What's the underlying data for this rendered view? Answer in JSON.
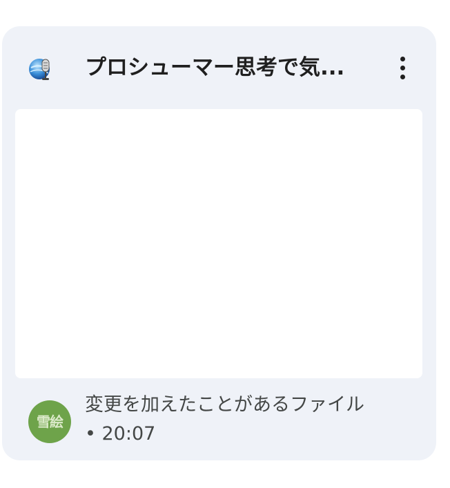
{
  "card": {
    "title": "プロシューマー思考で気...",
    "app_icon": "microphone-globe-icon",
    "more_icon": "more-vert-icon",
    "avatar_text": "雪絵",
    "activity_text": "変更を加えたことがあるファイル",
    "activity_time": "• 20:07"
  },
  "colors": {
    "card_bg": "#eff2f8",
    "avatar_bg": "#6ea34a",
    "title_color": "#1f1f1f",
    "meta_color": "#444746"
  }
}
